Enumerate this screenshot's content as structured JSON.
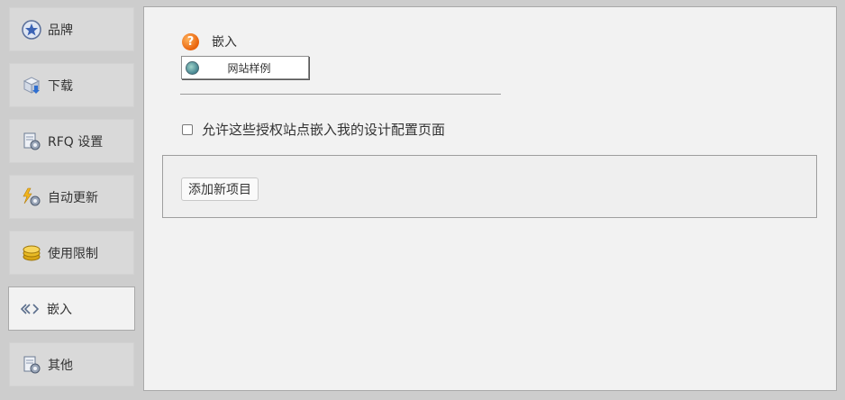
{
  "sidebar": {
    "items": [
      {
        "label": "品牌",
        "icon": "star-badge-icon"
      },
      {
        "label": "下载",
        "icon": "download-box-icon"
      },
      {
        "label": "RFQ 设置",
        "icon": "settings-document-icon"
      },
      {
        "label": "自动更新",
        "icon": "lightning-gear-icon"
      },
      {
        "label": "使用限制",
        "icon": "coins-icon"
      },
      {
        "label": "嵌入",
        "icon": "code-brackets-icon",
        "active": true
      },
      {
        "label": "其他",
        "icon": "settings-document-icon"
      }
    ]
  },
  "main": {
    "section_title": "嵌入",
    "example_button_label": "网站样例",
    "allow_embed_label": "允许这些授权站点嵌入我的设计配置页面",
    "allow_embed_checked": false,
    "add_item_label": "添加新项目"
  },
  "colors": {
    "help_icon": "#e8620c",
    "panel_background": "#f2f2f2",
    "page_background": "#cdcdcd"
  }
}
